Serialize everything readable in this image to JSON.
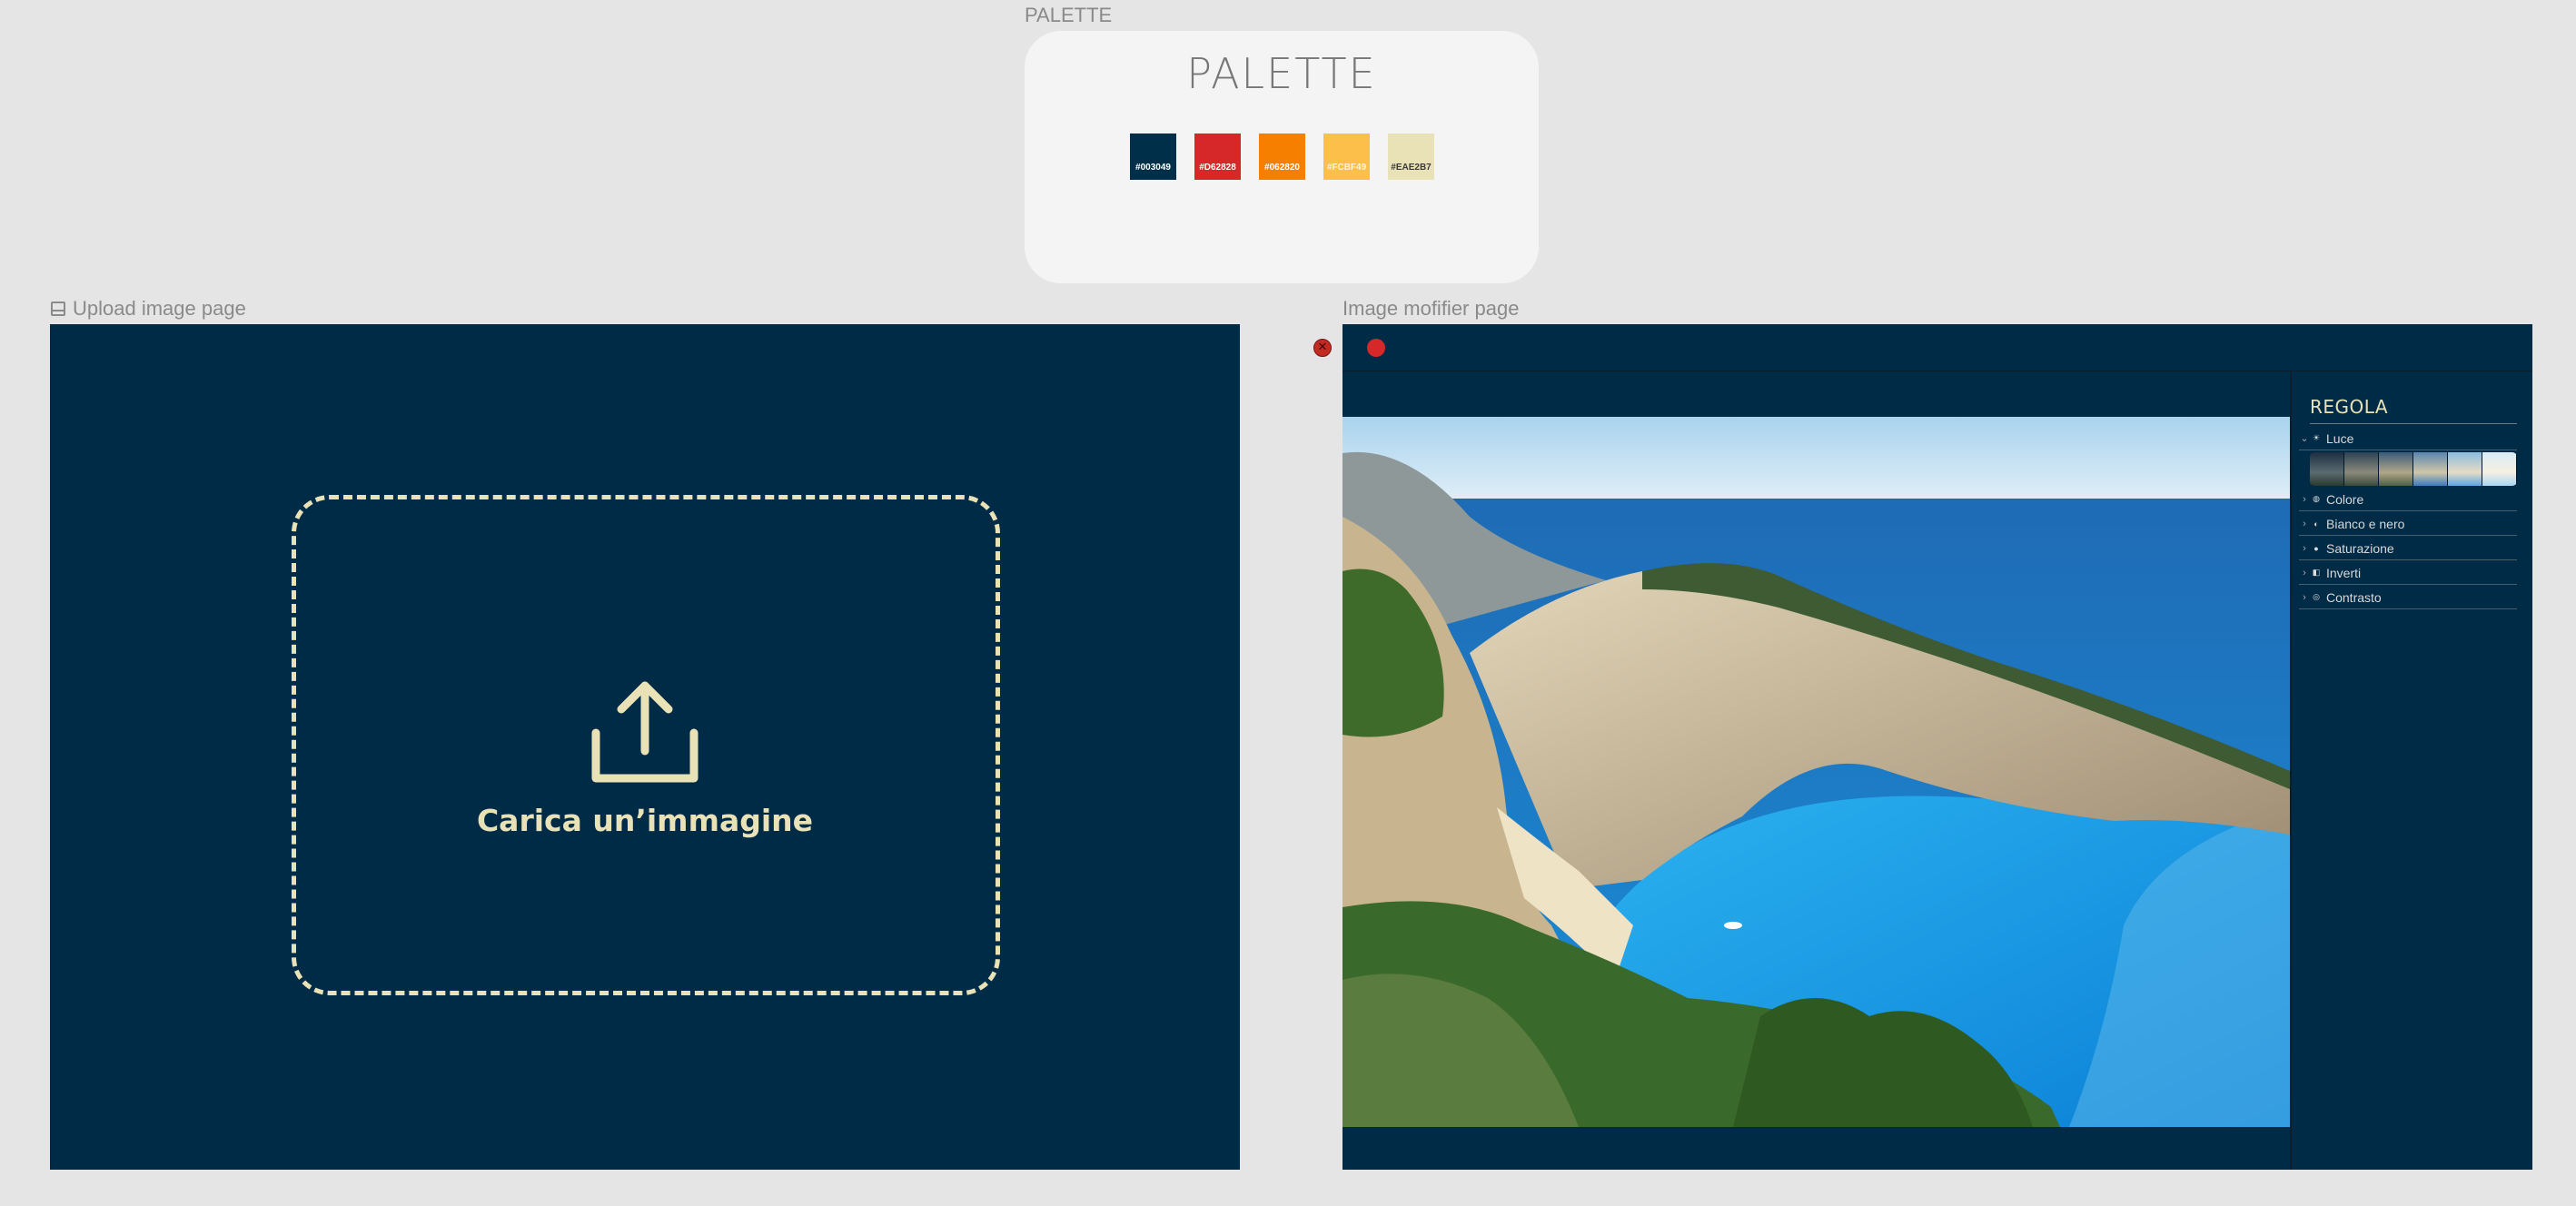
{
  "palette": {
    "frame_label": "PALETTE",
    "title": "PALETTE",
    "swatches": [
      {
        "hex": "#003049",
        "label": "#003049",
        "text_color": "#ffffff"
      },
      {
        "hex": "#D62828",
        "label": "#D62828",
        "text_color": "#ffffff"
      },
      {
        "hex": "#F77F00",
        "label": "#062820",
        "text_color": "#ffffff"
      },
      {
        "hex": "#FCBF49",
        "label": "#FCBF49",
        "text_color": "#fff4d8"
      },
      {
        "hex": "#EAE2B7",
        "label": "#EAE2B7",
        "text_color": "#3a3a3a"
      }
    ]
  },
  "upload_page": {
    "frame_label": "Upload image page",
    "upload_text": "Carica un’immagine",
    "accent": "#EAE2B7",
    "background": "#002B47"
  },
  "modifier_page": {
    "frame_label": "Image mofifier page",
    "panel": {
      "title": "REGOLA",
      "items": [
        {
          "label": "Luce",
          "icon": "sun-icon",
          "expanded": true
        },
        {
          "label": "Colore",
          "icon": "palette-icon",
          "expanded": false
        },
        {
          "label": "Bianco e nero",
          "icon": "half-circle-icon",
          "expanded": false
        },
        {
          "label": "Saturazione",
          "icon": "droplet-icon",
          "expanded": false
        },
        {
          "label": "Inverti",
          "icon": "invert-icon",
          "expanded": false
        },
        {
          "label": "Contrasto",
          "icon": "contrast-icon",
          "expanded": false
        }
      ]
    }
  }
}
